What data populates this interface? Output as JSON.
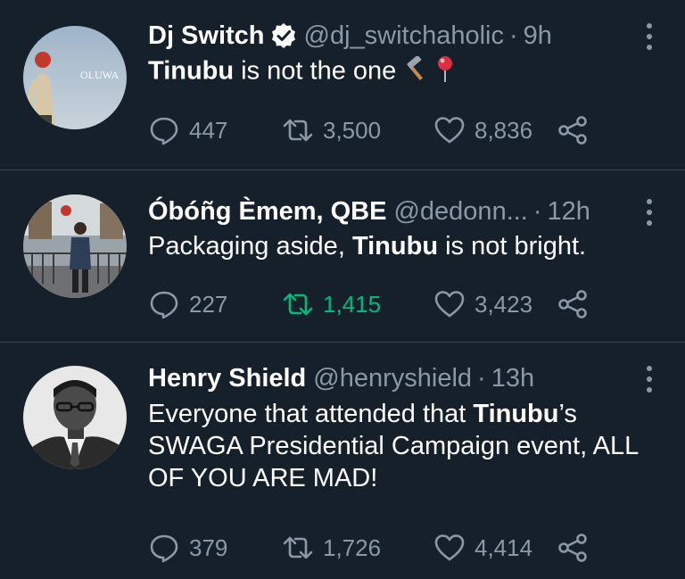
{
  "tweets": [
    {
      "name": "Dj Switch",
      "verified": true,
      "handle": "@dj_switchaholic",
      "time": "9h",
      "text_parts": [
        {
          "t": "Tinubu",
          "bold": true
        },
        {
          "t": " is not the one ",
          "bold": false
        }
      ],
      "emojis": [
        "hammer",
        "round-pushpin"
      ],
      "avatar_text": "OLUWA",
      "replies": "447",
      "retweets": "3,500",
      "likes": "8,836",
      "retweeted": false
    },
    {
      "name": "Óbóñg Èmem, QBE",
      "verified": false,
      "handle": "@dedonn...",
      "time": "12h",
      "text_parts": [
        {
          "t": "Packaging aside, ",
          "bold": false
        },
        {
          "t": "Tinubu",
          "bold": true
        },
        {
          "t": " is not bright.",
          "bold": false
        }
      ],
      "replies": "227",
      "retweets": "1,415",
      "likes": "3,423",
      "retweeted": true
    },
    {
      "name": "Henry Shield",
      "verified": false,
      "handle": "@henryshield",
      "time": "13h",
      "text_parts": [
        {
          "t": "Everyone that attended that ",
          "bold": false
        },
        {
          "t": "Tinubu",
          "bold": true
        },
        {
          "t": "’s SWAGA Presidential Campaign event, ALL OF YOU ARE MAD!",
          "bold": false
        }
      ],
      "replies": "379",
      "retweets": "1,726",
      "likes": "4,414",
      "retweeted": false
    }
  ],
  "colors": {
    "background": "#15202b",
    "secondary_text": "#8b98a5",
    "retweet_active": "#00ba7c",
    "verified_badge": "#ffffff",
    "divider": "#38444d"
  },
  "separator": "·"
}
